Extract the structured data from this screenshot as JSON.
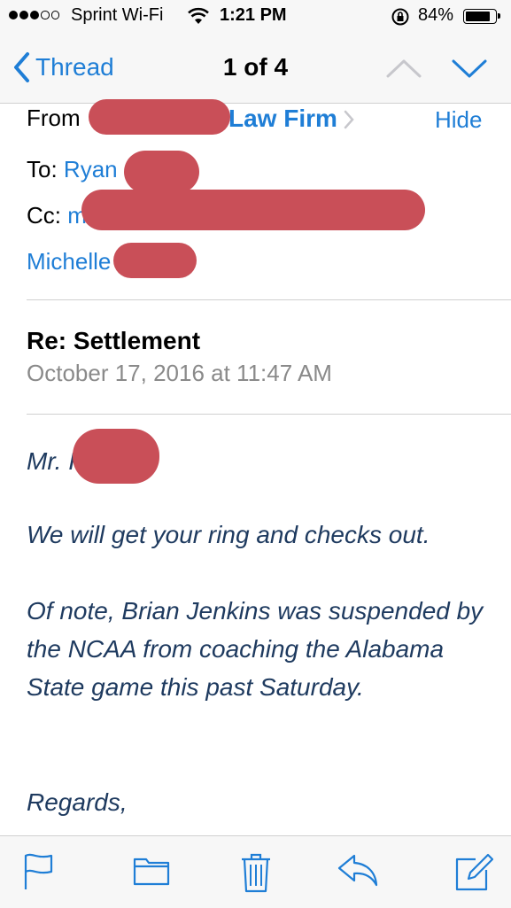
{
  "status_bar": {
    "carrier": "Sprint Wi-Fi",
    "time": "1:21 PM",
    "battery": "84%",
    "battery_level": 0.84
  },
  "nav": {
    "back_label": "Thread",
    "title": "1 of 4"
  },
  "header": {
    "from_label": "From",
    "from_visible": "Law Firm",
    "hide_label": "Hide",
    "to_label": "To:",
    "to_visible": "Ryan",
    "cc_label": "Cc:",
    "cc_visible": "m",
    "cc_second": "Michelle"
  },
  "message": {
    "subject": "Re: Settlement",
    "date": "October 17, 2016 at 11:47 AM",
    "greeting": "Mr. I",
    "paragraph1": "We will get your ring and checks out.",
    "paragraph2": "Of note, Brian Jenkins was suspended by the NCAA from coaching the Alabama State game this past Saturday.",
    "closing": "Regards,"
  },
  "colors": {
    "accent": "#1f7ed6",
    "redaction": "#c94f58",
    "body_text": "#1e3a5f"
  },
  "toolbar": {
    "icons": [
      "flag-icon",
      "folder-icon",
      "trash-icon",
      "reply-icon",
      "compose-icon"
    ]
  }
}
